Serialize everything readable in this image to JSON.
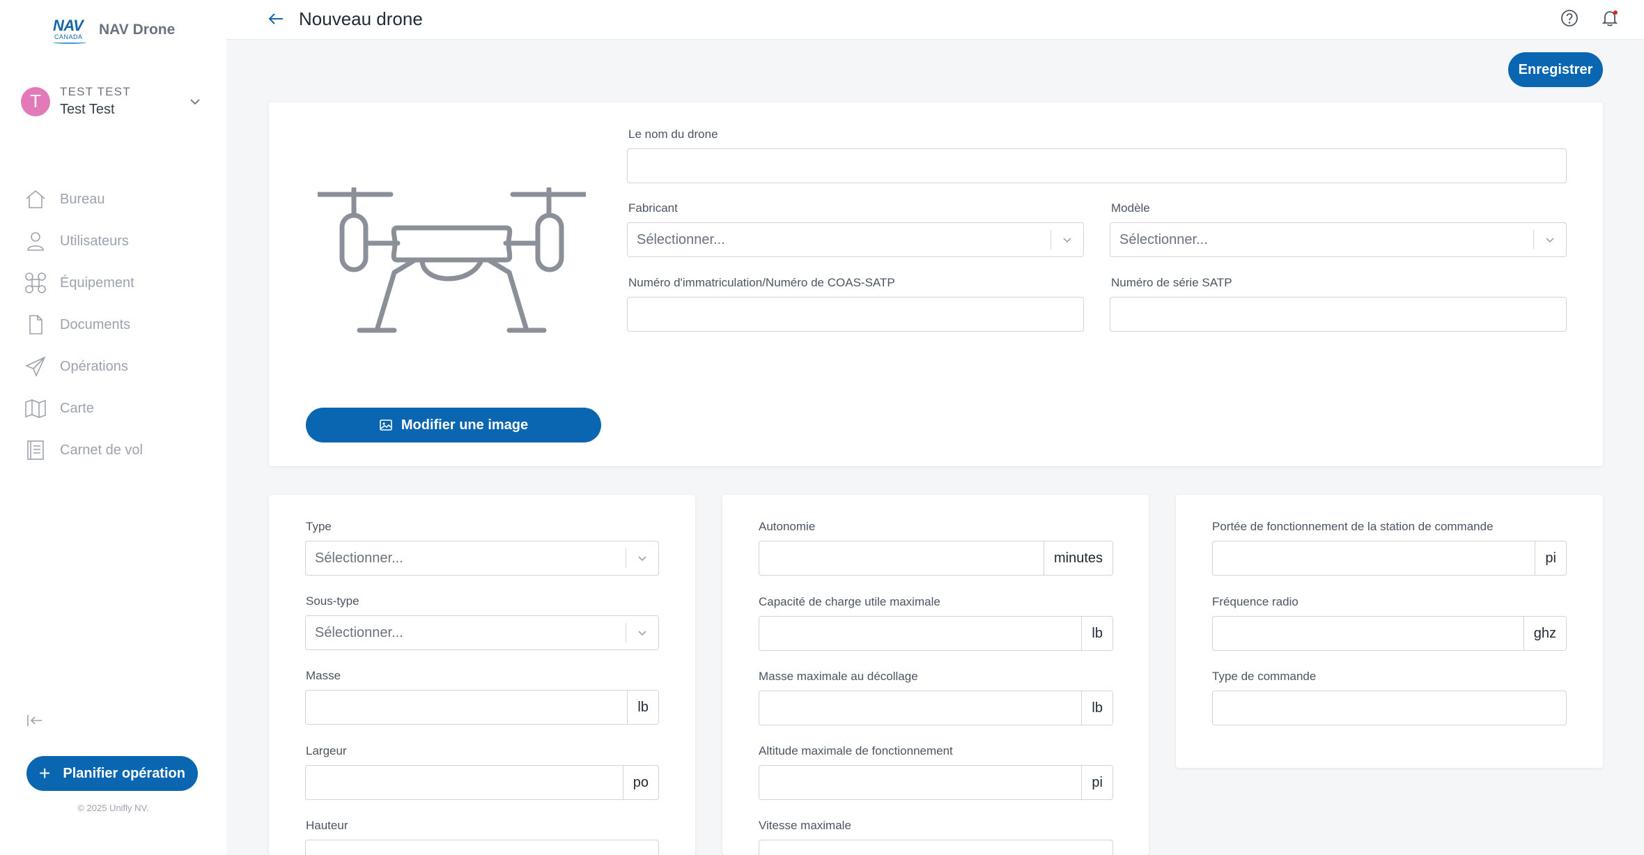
{
  "app": {
    "logo_top": "NAV",
    "logo_bottom": "CANADA",
    "name": "NAV Drone"
  },
  "user": {
    "initial": "T",
    "org": "TEST TEST",
    "name": "Test Test"
  },
  "sidebar": {
    "items": [
      {
        "label": "Bureau",
        "icon": "home-icon"
      },
      {
        "label": "Utilisateurs",
        "icon": "user-icon"
      },
      {
        "label": "Équipement",
        "icon": "drone-icon"
      },
      {
        "label": "Documents",
        "icon": "document-icon"
      },
      {
        "label": "Opérations",
        "icon": "paper-plane-icon"
      },
      {
        "label": "Carte",
        "icon": "map-icon"
      },
      {
        "label": "Carnet de vol",
        "icon": "logbook-icon"
      }
    ],
    "plan_button": "Planifier opération",
    "copyright": "© 2025 Unifly NV."
  },
  "header": {
    "title": "Nouveau drone"
  },
  "toolbar": {
    "save_label": "Enregistrer"
  },
  "main_card": {
    "image_button": "Modifier une image",
    "drone_name_label": "Le nom du drone",
    "manufacturer_label": "Fabricant",
    "manufacturer_placeholder": "Sélectionner...",
    "model_label": "Modèle",
    "model_placeholder": "Sélectionner...",
    "registration_label": "Numéro d'immatriculation/Numéro de COAS-SATP",
    "serial_label": "Numéro de série SATP"
  },
  "card_a": {
    "type_label": "Type",
    "type_placeholder": "Sélectionner...",
    "subtype_label": "Sous-type",
    "subtype_placeholder": "Sélectionner...",
    "mass_label": "Masse",
    "mass_unit": "lb",
    "width_label": "Largeur",
    "width_unit": "po",
    "height_label": "Hauteur"
  },
  "card_b": {
    "autonomy_label": "Autonomie",
    "autonomy_unit": "minutes",
    "payload_label": "Capacité de charge utile maximale",
    "payload_unit": "lb",
    "mtow_label": "Masse maximale au décollage",
    "mtow_unit": "lb",
    "altitude_label": "Altitude maximale de fonctionnement",
    "altitude_unit": "pi",
    "speed_label": "Vitesse maximale"
  },
  "card_c": {
    "range_label": "Portée de fonctionnement de la station de commande",
    "range_unit": "pi",
    "frequency_label": "Fréquence radio",
    "frequency_unit": "ghz",
    "command_type_label": "Type de commande"
  },
  "colors": {
    "accent": "#0a66b0",
    "avatar": "#e27ab9",
    "notification_dot": "#dc2626"
  }
}
